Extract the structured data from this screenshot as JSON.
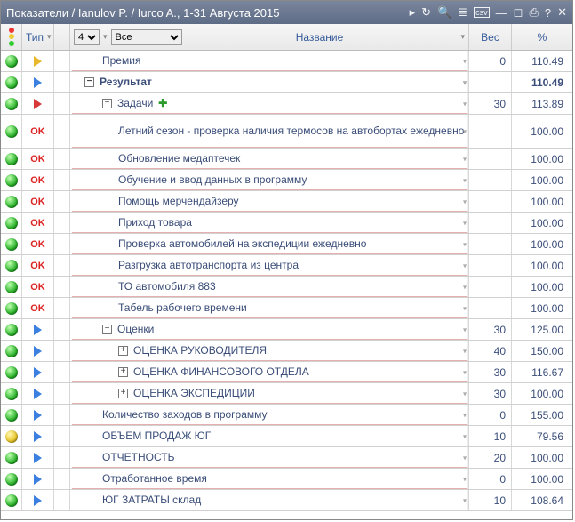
{
  "title": "Показатели / Ianulov P. / Iurco A., 1-31 Августа 2015",
  "toolbar_icons": [
    "refresh-icon",
    "search-icon",
    "tree-icon",
    "csv-icon",
    "minimize-icon",
    "restore-icon",
    "print-icon",
    "help-icon",
    "close-icon"
  ],
  "headers": {
    "type": "Тип",
    "level_select": "4",
    "filter_select": "Все",
    "name": "Название",
    "weight": "Вес",
    "percent": "%"
  },
  "ok_label": "OK",
  "rows": [
    {
      "status": "green",
      "type": "tri-yellow",
      "indent": 2,
      "name": "Премия",
      "weight": "0",
      "pct": "110.49",
      "bold": false
    },
    {
      "status": "green",
      "type": "tri-blue",
      "indent": 1,
      "exp": "minus",
      "name": "Результат",
      "weight": "",
      "pct": "110.49",
      "bold": true
    },
    {
      "status": "green",
      "type": "tri-red",
      "indent": 2,
      "exp": "minus",
      "name": "Задачи",
      "plus": true,
      "weight": "30",
      "pct": "113.89",
      "bold": false
    },
    {
      "status": "green",
      "type": "ok",
      "indent": 3,
      "name": "Летний сезон - проверка наличия термосов на автобортах ежедневно",
      "weight": "",
      "pct": "100.00",
      "tall": true
    },
    {
      "status": "green",
      "type": "ok",
      "indent": 3,
      "name": "Обновление медаптечек",
      "weight": "",
      "pct": "100.00"
    },
    {
      "status": "green",
      "type": "ok",
      "indent": 3,
      "name": "Обучение и ввод данных в программу",
      "weight": "",
      "pct": "100.00"
    },
    {
      "status": "green",
      "type": "ok",
      "indent": 3,
      "name": "Помощь мерчендайзеру",
      "weight": "",
      "pct": "100.00"
    },
    {
      "status": "green",
      "type": "ok",
      "indent": 3,
      "name": "Приход товара",
      "weight": "",
      "pct": "100.00"
    },
    {
      "status": "green",
      "type": "ok",
      "indent": 3,
      "name": "Проверка автомобилей на экспедиции ежедневно",
      "weight": "",
      "pct": "100.00"
    },
    {
      "status": "green",
      "type": "ok",
      "indent": 3,
      "name": "Разгрузка автотранспорта из центра",
      "weight": "",
      "pct": "100.00"
    },
    {
      "status": "green",
      "type": "ok",
      "indent": 3,
      "name": "ТО автомобиля 883",
      "weight": "",
      "pct": "100.00"
    },
    {
      "status": "green",
      "type": "ok",
      "indent": 3,
      "name": "Табель рабочего времени",
      "weight": "",
      "pct": "100.00"
    },
    {
      "status": "green",
      "type": "tri-blue",
      "indent": 2,
      "exp": "minus",
      "name": "Оценки",
      "weight": "30",
      "pct": "125.00"
    },
    {
      "status": "green",
      "type": "tri-blue",
      "indent": 3,
      "exp": "plus",
      "name": "ОЦЕНКА РУКОВОДИТЕЛЯ",
      "weight": "40",
      "pct": "150.00"
    },
    {
      "status": "green",
      "type": "tri-blue",
      "indent": 3,
      "exp": "plus",
      "name": "ОЦЕНКА ФИНАНСОВОГО ОТДЕЛА",
      "weight": "30",
      "pct": "116.67"
    },
    {
      "status": "green",
      "type": "tri-blue",
      "indent": 3,
      "exp": "plus",
      "name": "ОЦЕНКА ЭКСПЕДИЦИИ",
      "weight": "30",
      "pct": "100.00"
    },
    {
      "status": "green",
      "type": "tri-blue",
      "indent": 2,
      "name": "Количество заходов в программу",
      "weight": "0",
      "pct": "155.00"
    },
    {
      "status": "yellow",
      "type": "tri-blue",
      "indent": 2,
      "name": "ОБЪЕМ ПРОДАЖ ЮГ",
      "weight": "10",
      "pct": "79.56"
    },
    {
      "status": "green",
      "type": "tri-blue",
      "indent": 2,
      "name": "ОТЧЕТНОСТЬ",
      "weight": "20",
      "pct": "100.00"
    },
    {
      "status": "green",
      "type": "tri-blue",
      "indent": 2,
      "name": "Отработанное время",
      "weight": "0",
      "pct": "100.00"
    },
    {
      "status": "green",
      "type": "tri-blue",
      "indent": 2,
      "name": "ЮГ ЗАТРАТЫ склад",
      "weight": "10",
      "pct": "108.64"
    }
  ]
}
